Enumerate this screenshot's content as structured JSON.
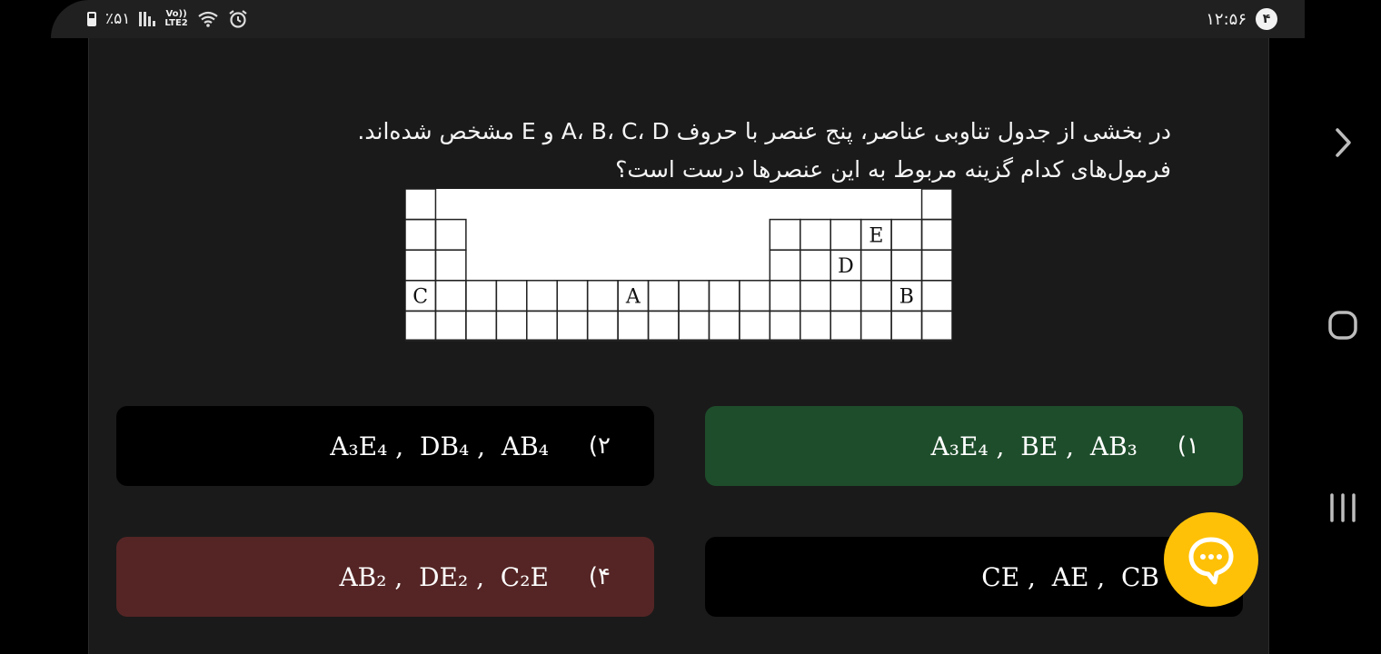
{
  "status_bar": {
    "battery_percent": "٪۵۱",
    "network_label": "LTE2",
    "volte_label": "Vo))",
    "time": "۱۲:۵۶",
    "notification_count": "۴"
  },
  "question": {
    "line1": "در بخشی از جدول تناوبی عناصر، پنج عنصر با حروف A، B، C، D و E مشخص شده‌اند.",
    "line2": "فرمول‌های کدام گزینه مربوط به این عنصرها درست است؟"
  },
  "periodic_table": {
    "labels": [
      {
        "letter": "E",
        "row": 2,
        "col": 16
      },
      {
        "letter": "D",
        "row": 3,
        "col": 15
      },
      {
        "letter": "C",
        "row": 4,
        "col": 1
      },
      {
        "letter": "A",
        "row": 4,
        "col": 8
      },
      {
        "letter": "B",
        "row": 4,
        "col": 17
      }
    ]
  },
  "options": [
    {
      "number": "(۱",
      "formula": "A₃E₄ ,  BE ,  AB₃",
      "state": "correct",
      "color": "#1e4d2b"
    },
    {
      "number": "(۲",
      "formula": "A₃E₄ ,  DB₄ ,  AB₄",
      "state": "normal",
      "color": "#000000"
    },
    {
      "number": "",
      "formula": "CE ,  AE ,  CB",
      "state": "normal",
      "color": "#000000"
    },
    {
      "number": "(۴",
      "formula": "AB₂ ,  DE₂ ,  C₂E",
      "state": "wrong",
      "color": "#552525"
    }
  ],
  "colors": {
    "correct": "#1e4d2b",
    "wrong": "#552525",
    "fab": "#ffc107",
    "statusbar": "#202020",
    "content_bg": "#1a1a1a"
  },
  "icons": {
    "fab": "chat-bubble-icon",
    "nav_next": "chevron-right-icon",
    "nav_home": "home-icon",
    "nav_recents": "recents-icon"
  }
}
